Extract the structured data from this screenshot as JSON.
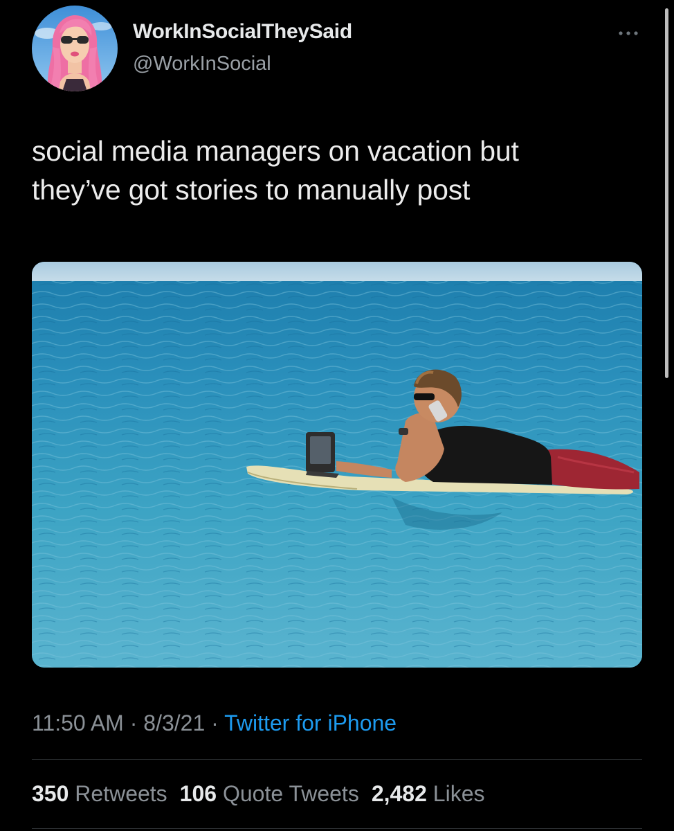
{
  "author": {
    "display_name": "WorkInSocialTheySaid",
    "handle": "@WorkInSocial",
    "avatar_icon": "avatar-pink-hair-icon"
  },
  "more_icon": "more-horizontal-icon",
  "tweet": {
    "text_line1": "social media managers on vacation but",
    "text_line2": "they’ve got stories to manually post"
  },
  "meta": {
    "time": "11:50 AM",
    "sep1": " · ",
    "date": "8/3/21",
    "sep2": " · ",
    "source": "Twitter for iPhone"
  },
  "stats": {
    "retweets_count": "350",
    "retweets_label": "Retweets",
    "quotes_count": "106",
    "quotes_label": "Quote Tweets",
    "likes_count": "2,482",
    "likes_label": "Likes"
  },
  "colors": {
    "background": "#000000",
    "link": "#1d9bf0",
    "secondary_text": "#8b9197"
  }
}
